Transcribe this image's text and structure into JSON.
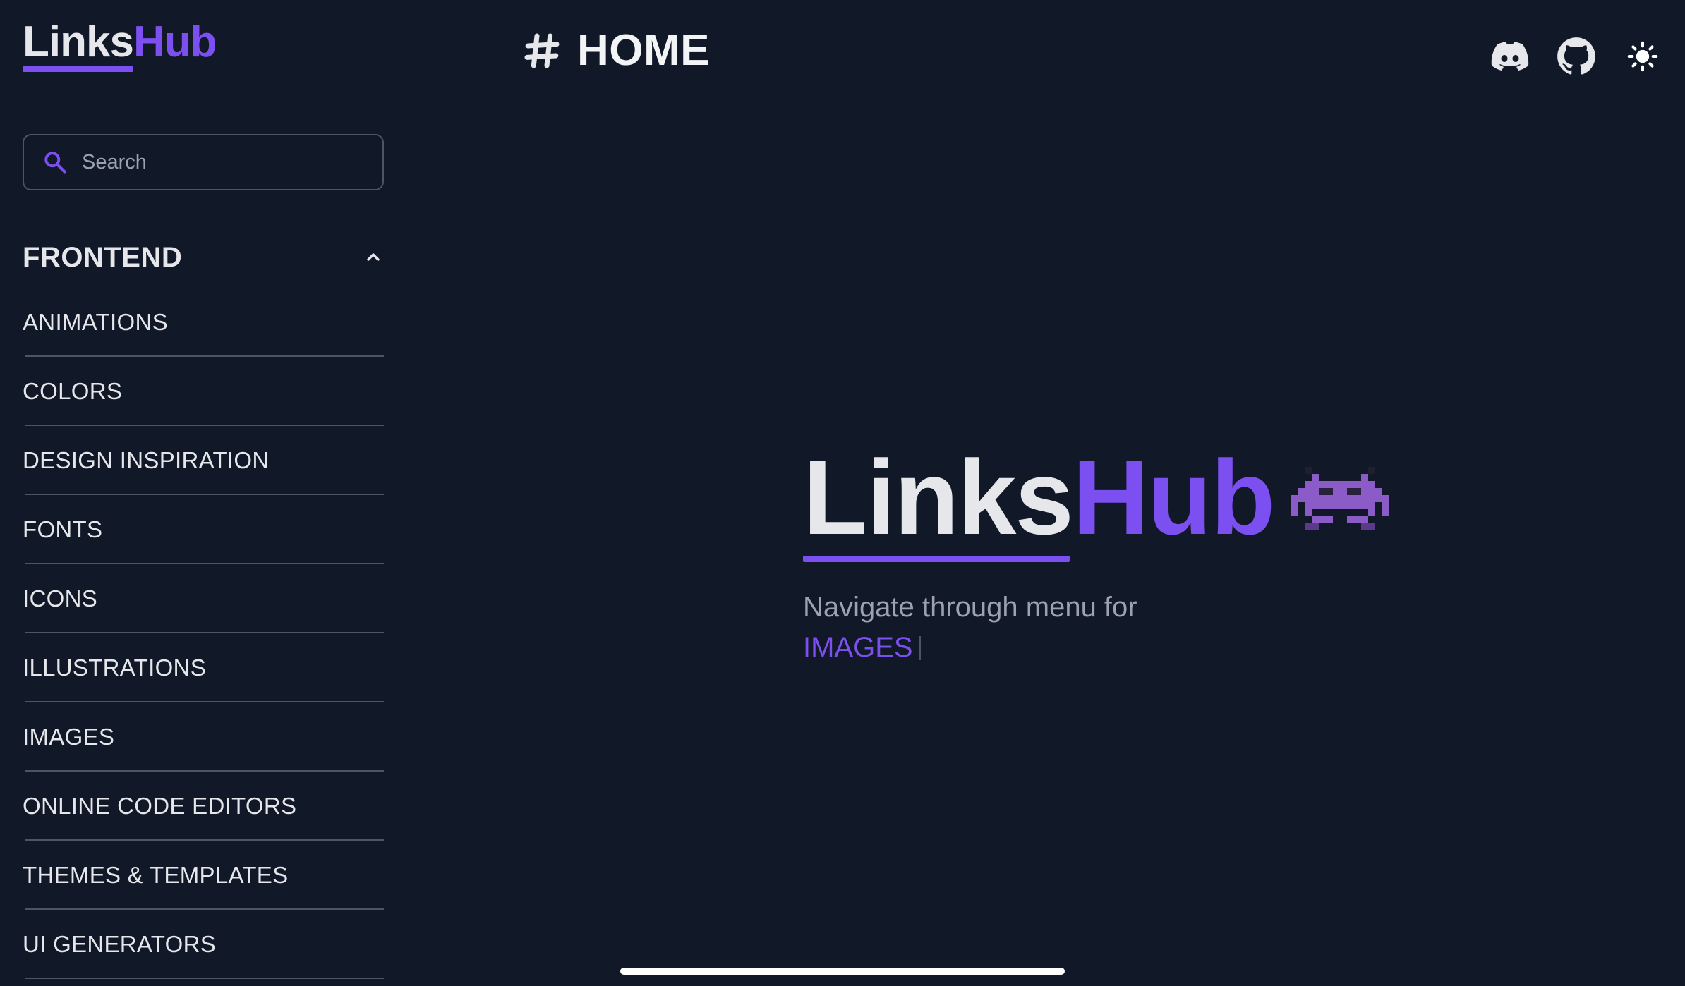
{
  "logo": {
    "part1": "Links",
    "part2": "Hub"
  },
  "search": {
    "placeholder": "Search",
    "value": ""
  },
  "sidebar": {
    "section_title": "FRONTEND",
    "items": [
      {
        "label": "ANIMATIONS"
      },
      {
        "label": "COLORS"
      },
      {
        "label": "DESIGN INSPIRATION"
      },
      {
        "label": "FONTS"
      },
      {
        "label": "ICONS"
      },
      {
        "label": "ILLUSTRATIONS"
      },
      {
        "label": "IMAGES"
      },
      {
        "label": "ONLINE CODE EDITORS"
      },
      {
        "label": "THEMES & TEMPLATES"
      },
      {
        "label": "UI GENERATORS"
      }
    ]
  },
  "header": {
    "title": "HOME",
    "icons": [
      "discord-icon",
      "github-icon",
      "sun-icon"
    ]
  },
  "hero": {
    "title_part1": "Links",
    "title_part2": "Hub",
    "emoji": "alien-monster-icon",
    "subtitle": "Navigate through menu for",
    "typed": "IMAGES"
  },
  "colors": {
    "background": "#111827",
    "accent": "#7c4ff0",
    "text": "#e5e7eb",
    "muted": "#9ca3af",
    "border": "#4b5563"
  }
}
